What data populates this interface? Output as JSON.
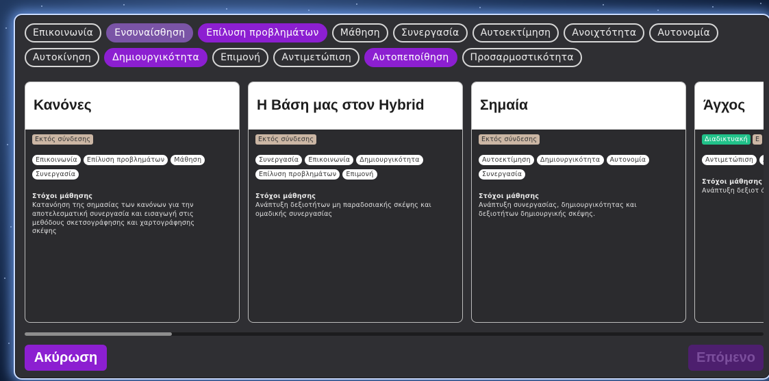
{
  "filters": [
    {
      "label": "Επικοινωνία",
      "state": "off"
    },
    {
      "label": "Ενσυναίσθηση",
      "state": "soft"
    },
    {
      "label": "Επίλυση προβλημάτων",
      "state": "on"
    },
    {
      "label": "Μάθηση",
      "state": "off"
    },
    {
      "label": "Συνεργασία",
      "state": "off"
    },
    {
      "label": "Αυτοεκτίμηση",
      "state": "off"
    },
    {
      "label": "Ανοιχτότητα",
      "state": "off"
    },
    {
      "label": "Αυτονομία",
      "state": "off"
    },
    {
      "label": "Αυτοκίνηση",
      "state": "off"
    },
    {
      "label": "Δημιουργικότητα",
      "state": "on"
    },
    {
      "label": "Επιμονή",
      "state": "off"
    },
    {
      "label": "Αντιμετώπιση",
      "state": "off"
    },
    {
      "label": "Αυτοπεποίθηση",
      "state": "on"
    },
    {
      "label": "Προσαρμοστικότητα",
      "state": "off"
    }
  ],
  "goals_heading": "Στόχοι μάθησης",
  "cards": [
    {
      "title": "Κανόνες",
      "modes": [
        {
          "label": "Εκτός σύνδεσης",
          "type": "offline"
        }
      ],
      "tags": [
        "Επικοινωνία",
        "Επίλυση προβλημάτων",
        "Μάθηση",
        "Συνεργασία"
      ],
      "goals": "Κατανόηση της σημασίας των κανόνων για την αποτελεσματική συνεργασία και εισαγωγή στις μεθόδους σκετσογράφησης και χαρτογράφησης σκέψης"
    },
    {
      "title": "Η Βάση μας στον Hybrid",
      "modes": [
        {
          "label": "Εκτός σύνδεσης",
          "type": "offline"
        }
      ],
      "tags": [
        "Συνεργασία",
        "Επικοινωνία",
        "Δημιουργικότητα",
        "Επίλυση προβλημάτων",
        "Επιμονή"
      ],
      "goals": "Ανάπτυξη δεξιοτήτων μη παραδοσιακής σκέψης και ομαδικής συνεργασίας"
    },
    {
      "title": "Σημαία",
      "modes": [
        {
          "label": "Εκτός σύνδεσης",
          "type": "offline"
        }
      ],
      "tags": [
        "Αυτοεκτίμηση",
        "Δημιουργικότητα",
        "Αυτονομία",
        "Συνεργασία"
      ],
      "goals": "Ανάπτυξη συνεργασίας, δημιουργικότητας και δεξιοτήτων δημιουργικής σκέψης."
    },
    {
      "title": "Άγχος",
      "modes": [
        {
          "label": "Διαδικτυακή",
          "type": "online"
        },
        {
          "label": "Ε",
          "type": "offline"
        }
      ],
      "tags": [
        "Αντιμετώπιση",
        "Αυτοεκτίμηση"
      ],
      "goals": "Ανάπτυξη δεξιοτ άγχος"
    }
  ],
  "buttons": {
    "cancel": "Ακύρωση",
    "next": "Επόμενο"
  },
  "colors": {
    "accent": "#8c1fd1",
    "selected_soft": "#7a54a6",
    "offline_badge": "#cbb6a4",
    "online_badge": "#21c28a"
  }
}
